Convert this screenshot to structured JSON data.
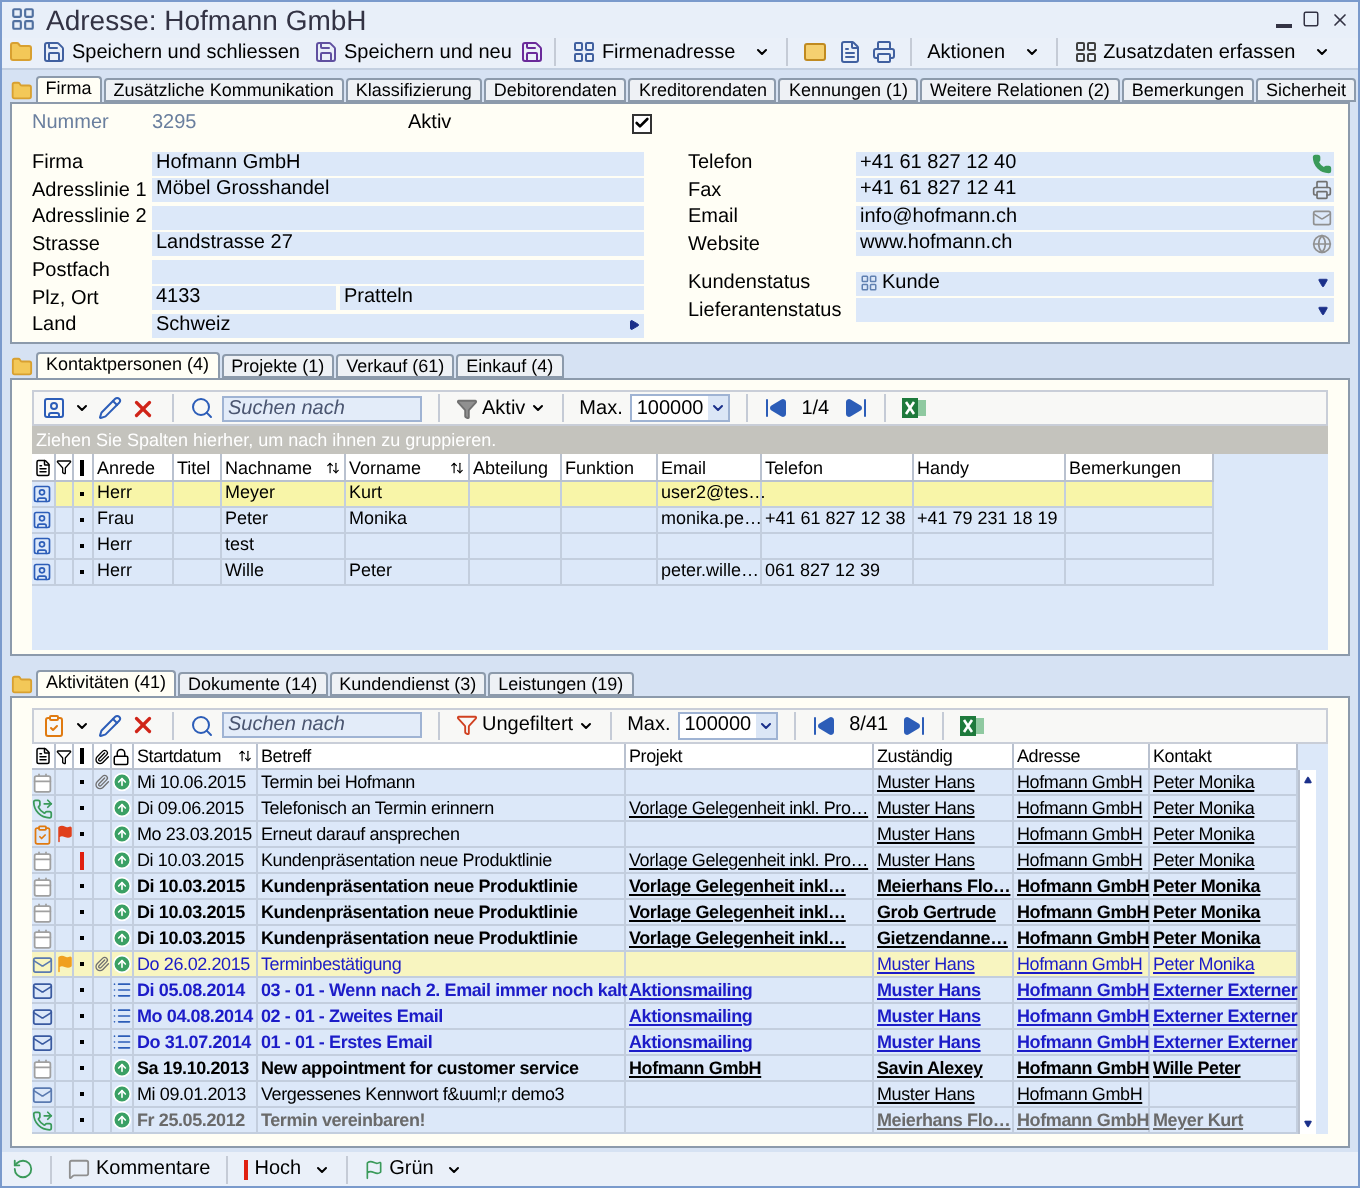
{
  "window": {
    "title": "Adresse: Hofmann GmbH"
  },
  "toolbar": [
    {
      "label": "Speichern und schliessen",
      "menu": false
    },
    {
      "label": "Speichern und neu",
      "menu": false
    },
    {
      "label": "Firmenadresse",
      "menu": true
    },
    {
      "label": "Aktionen",
      "menu": true
    },
    {
      "label": "Zusatzdaten erfassen",
      "menu": true
    }
  ],
  "tabs": [
    {
      "label": "Firma",
      "selected": true
    },
    {
      "label": "Zusätzliche Kommunikation",
      "selected": false
    },
    {
      "label": "Klassifizierung",
      "selected": false
    },
    {
      "label": "Debitorendaten",
      "selected": false
    },
    {
      "label": "Kreditorendaten",
      "selected": false
    },
    {
      "label": "Kennungen (1)",
      "selected": false
    },
    {
      "label": "Weitere Relationen (2)",
      "selected": false
    },
    {
      "label": "Bemerkungen",
      "selected": false
    },
    {
      "label": "Sicherheit",
      "selected": false
    }
  ],
  "firma": {
    "number_label": "Nummer",
    "number": "3295",
    "aktiv_label": "Aktiv",
    "aktiv_checked": true,
    "left_fields": [
      {
        "label": "Firma",
        "kind": "text",
        "values": [
          "Hofmann GmbH"
        ]
      },
      {
        "label": "Adresslinie 1",
        "kind": "text",
        "values": [
          "Möbel Grosshandel"
        ]
      },
      {
        "label": "Adresslinie 2",
        "kind": "text"
      },
      {
        "label": "Strasse",
        "kind": "text",
        "values": [
          "Landstrasse 27"
        ]
      },
      {
        "label": "Postfach",
        "kind": "text"
      },
      {
        "label": "Plz, Ort",
        "kind": "text",
        "values": [
          "4133",
          "Pratteln"
        ]
      },
      {
        "label": "Land",
        "kind": "select",
        "values": [
          "Schweiz"
        ]
      }
    ],
    "right_fields": [
      {
        "label": "Telefon",
        "kind": "phone",
        "value": "+41 61 827 12 40"
      },
      {
        "label": "Fax",
        "kind": "fax",
        "value": "+41 61 827 12 41"
      },
      {
        "label": "Email",
        "kind": "email",
        "value": "info@hofmann.ch"
      },
      {
        "label": "Website",
        "kind": "web",
        "value": "www.hofmann.ch"
      }
    ],
    "status_fields": [
      {
        "label": "Kundenstatus",
        "value": "Kunde"
      },
      {
        "label": "Lieferantenstatus"
      }
    ]
  },
  "contacts": {
    "tabs": [
      {
        "label": "Kontaktpersonen (4)",
        "selected": true
      },
      {
        "label": "Projekte (1)",
        "selected": false
      },
      {
        "label": "Verkauf (61)",
        "selected": false
      },
      {
        "label": "Einkauf (4)",
        "selected": false
      }
    ],
    "search_placeholder": "Suchen nach",
    "filter": "Aktiv",
    "max_label": "Max.",
    "max_value": "100000",
    "page": "1/4",
    "group_hint": "Ziehen Sie Spalten hierher, um nach ihnen zu gruppieren.",
    "columns": [
      {
        "label": "Anrede",
        "sorted": false
      },
      {
        "label": "Titel",
        "sorted": false
      },
      {
        "label": "Nachname",
        "sorted": true
      },
      {
        "label": "Vorname",
        "sorted": true
      },
      {
        "label": "Abteilung",
        "sorted": false
      },
      {
        "label": "Funktion",
        "sorted": false
      },
      {
        "label": "Email",
        "sorted": false
      },
      {
        "label": "Telefon",
        "sorted": false
      },
      {
        "label": "Handy",
        "sorted": false
      },
      {
        "label": "Bemerkungen",
        "sorted": false
      }
    ],
    "rows": [
      {
        "selected": true,
        "cells": [
          "Herr",
          null,
          "Meyer",
          "Kurt",
          null,
          null,
          "user2@tes…",
          null,
          null,
          null
        ]
      },
      {
        "selected": false,
        "cells": [
          "Frau",
          null,
          "Peter",
          "Monika",
          null,
          null,
          "monika.pe…",
          "+41 61 827 12 38",
          "+41 79 231 18 19",
          null
        ]
      },
      {
        "selected": false,
        "cells": [
          "Herr",
          null,
          "test",
          null,
          null,
          null,
          null,
          null,
          null,
          null
        ]
      },
      {
        "selected": false,
        "cells": [
          "Herr",
          null,
          "Wille",
          "Peter",
          null,
          null,
          "peter.wille…",
          "061 827 12 39",
          null,
          null
        ]
      }
    ]
  },
  "activities": {
    "tabs": [
      {
        "label": "Aktivitäten (41)",
        "selected": true
      },
      {
        "label": "Dokumente (14)",
        "selected": false
      },
      {
        "label": "Kundendienst (3)",
        "selected": false
      },
      {
        "label": "Leistungen (19)",
        "selected": false
      }
    ],
    "search_placeholder": "Suchen nach",
    "filter": "Ungefiltert",
    "max_label": "Max.",
    "max_value": "100000",
    "page": "8/41",
    "columns": [
      {
        "label": "Startdatum",
        "sorted": true
      },
      {
        "label": "Betreff",
        "sorted": false
      },
      {
        "label": "Projekt",
        "sorted": false
      },
      {
        "label": "Zuständig",
        "sorted": false
      },
      {
        "label": "Adresse",
        "sorted": false
      },
      {
        "label": "Kontakt",
        "sorted": false
      }
    ],
    "rows": [
      {
        "kind": "appointment",
        "unread": false,
        "color": "#000000",
        "selected": false,
        "high_priority": false,
        "attachment": true,
        "date": "Mi 10.06.2015",
        "subject": "Termin bei Hofmann",
        "project": null,
        "responsible": "Muster Hans",
        "address": "Hofmann GmbH",
        "contact": "Peter Monika"
      },
      {
        "kind": "call",
        "unread": false,
        "color": "#000000",
        "selected": false,
        "high_priority": false,
        "attachment": false,
        "date": "Di 09.06.2015",
        "subject": "Telefonisch an Termin erinnern",
        "project": "Vorlage Gelegenheit inkl. Pro…",
        "responsible": "Muster Hans",
        "address": "Hofmann GmbH",
        "contact": "Peter Monika"
      },
      {
        "kind": "task",
        "unread": false,
        "color": "#000000",
        "selected": false,
        "flag": {
          "color": "#e0401c"
        },
        "high_priority": false,
        "attachment": false,
        "date": "Mo 23.03.2015",
        "subject": "Erneut darauf ansprechen",
        "project": null,
        "responsible": "Muster Hans",
        "address": "Hofmann GmbH",
        "contact": "Peter Monika"
      },
      {
        "kind": "appointment",
        "unread": false,
        "color": "#000000",
        "selected": false,
        "high_priority": true,
        "attachment": false,
        "date": "Di 10.03.2015",
        "subject": "Kundenpräsentation neue Produktlinie",
        "project": "Vorlage Gelegenheit inkl. Pro…",
        "responsible": "Muster Hans",
        "address": "Hofmann GmbH",
        "contact": "Peter Monika"
      },
      {
        "kind": "appointment",
        "unread": true,
        "color": "#000000",
        "selected": false,
        "high_priority": false,
        "attachment": false,
        "date": "Di 10.03.2015",
        "subject": "Kundenpräsentation neue Produktlinie",
        "project": "Vorlage Gelegenheit inkl…",
        "responsible": "Meierhans Flo…",
        "address": "Hofmann GmbH",
        "contact": "Peter Monika"
      },
      {
        "kind": "appointment",
        "unread": true,
        "color": "#000000",
        "selected": false,
        "high_priority": false,
        "attachment": false,
        "date": "Di 10.03.2015",
        "subject": "Kundenpräsentation neue Produktlinie",
        "project": "Vorlage Gelegenheit inkl…",
        "responsible": "Grob Gertrude",
        "address": "Hofmann GmbH",
        "contact": "Peter Monika"
      },
      {
        "kind": "appointment",
        "unread": true,
        "color": "#000000",
        "selected": false,
        "high_priority": false,
        "attachment": false,
        "date": "Di 10.03.2015",
        "subject": "Kundenpräsentation neue Produktlinie",
        "project": "Vorlage Gelegenheit inkl…",
        "responsible": "Gietzendanne…",
        "address": "Hofmann GmbH",
        "contact": "Peter Monika"
      },
      {
        "kind": "email",
        "unread": false,
        "color": "#1c1cc8",
        "selected": true,
        "flag": {
          "color": "#f0a020"
        },
        "high_priority": false,
        "attachment": true,
        "date": "Do 26.02.2015",
        "subject": "Terminbestätigung",
        "project": null,
        "responsible": "Muster Hans",
        "address": "Hofmann GmbH",
        "contact": "Peter Monika"
      },
      {
        "kind": "mailing",
        "unread": true,
        "color": "#1c1cc8",
        "selected": false,
        "high_priority": false,
        "attachment": false,
        "date": "Di 05.08.2014",
        "subject": "03 - 01 - Wenn nach 2. Email immer noch kalt",
        "project": "Aktionsmailing",
        "responsible": "Muster Hans",
        "address": "Hofmann GmbH",
        "contact": "Externer Externer"
      },
      {
        "kind": "mailing",
        "unread": true,
        "color": "#1c1cc8",
        "selected": false,
        "high_priority": false,
        "attachment": false,
        "date": "Mo 04.08.2014",
        "subject": "02 - 01 - Zweites Email",
        "project": "Aktionsmailing",
        "responsible": "Muster Hans",
        "address": "Hofmann GmbH",
        "contact": "Externer Externer"
      },
      {
        "kind": "mailing",
        "unread": true,
        "color": "#1c1cc8",
        "selected": false,
        "high_priority": false,
        "attachment": false,
        "date": "Do 31.07.2014",
        "subject": "01 - 01 - Erstes Email",
        "project": "Aktionsmailing",
        "responsible": "Muster Hans",
        "address": "Hofmann GmbH",
        "contact": "Externer Externer"
      },
      {
        "kind": "appointment",
        "unread": true,
        "color": "#000000",
        "selected": false,
        "high_priority": false,
        "attachment": false,
        "date": "Sa 19.10.2013",
        "subject": "New appointment for customer service",
        "project": "Hofmann GmbH",
        "responsible": "Savin Alexey",
        "address": "Hofmann GmbH",
        "contact": "Wille Peter"
      },
      {
        "kind": "email",
        "unread": false,
        "color": "#000000",
        "selected": false,
        "high_priority": false,
        "attachment": false,
        "date": "Mi 09.01.2013",
        "subject": "Vergessenes Kennwort f&uuml;r demo3",
        "project": null,
        "responsible": "Muster Hans",
        "address": "Hofmann GmbH",
        "contact": null
      },
      {
        "kind": "call",
        "unread": true,
        "color": "#6a6a6a",
        "selected": false,
        "high_priority": false,
        "attachment": false,
        "date": "Fr 25.05.2012",
        "subject": "Termin vereinbaren!",
        "project": null,
        "responsible": "Meierhans Flo…",
        "address": "Hofmann GmbH",
        "contact": "Meyer Kurt"
      }
    ]
  },
  "bottom_bar": {
    "comments": "Kommentare",
    "priority": "Hoch",
    "flag": "Grün"
  }
}
